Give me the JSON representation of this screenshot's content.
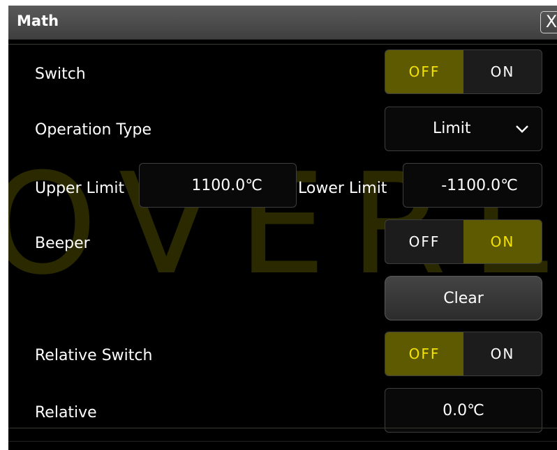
{
  "dialog": {
    "title": "Math",
    "close_symbol": "X"
  },
  "watermark": "OVERLO",
  "switch": {
    "label": "Switch",
    "off": "OFF",
    "on": "ON",
    "selected": "OFF"
  },
  "operation_type": {
    "label": "Operation Type",
    "value": "Limit"
  },
  "upper_limit": {
    "label": "Upper Limit",
    "value": "1100.0℃"
  },
  "lower_limit": {
    "label": "Lower Limit",
    "value": "-1100.0℃"
  },
  "beeper": {
    "label": "Beeper",
    "off": "OFF",
    "on": "ON",
    "selected": "ON"
  },
  "clear_button": {
    "label": "Clear"
  },
  "relative_switch": {
    "label": "Relative Switch",
    "off": "OFF",
    "on": "ON",
    "selected": "OFF"
  },
  "relative": {
    "label": "Relative",
    "value": "0.0℃"
  },
  "colors": {
    "accent_text": "#f4e300",
    "accent_bg": "#5e5a02",
    "background": "#000000"
  }
}
